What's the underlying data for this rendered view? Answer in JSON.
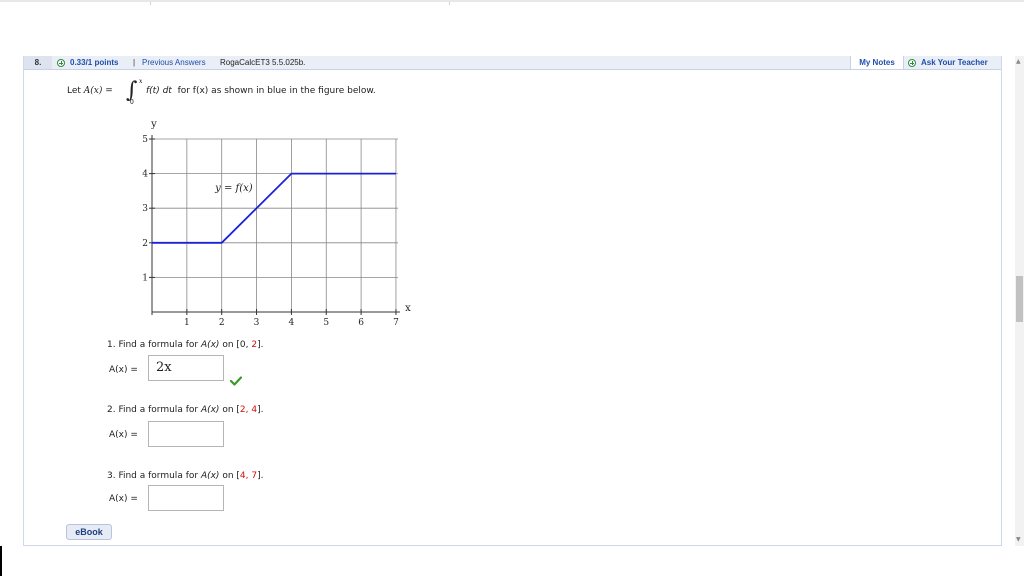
{
  "question": {
    "number": "8.",
    "points": "0.33/1 points",
    "separator": "|",
    "previous_answers": "Previous Answers",
    "code": "RogaCalcET3 5.5.025b.",
    "my_notes": "My Notes",
    "ask_teacher": "Ask Your Teacher"
  },
  "prompt": {
    "let_text": "Let",
    "A_of_x": "A(x) =",
    "integral_sign": "∫",
    "upper_limit": "x",
    "lower_limit": "0",
    "integrand": "f(t) dt",
    "rest": "for f(x) as shown in blue in the figure below."
  },
  "chart_data": {
    "type": "line",
    "ylabel": "y",
    "xlabel": "x",
    "xlim": [
      0,
      7
    ],
    "ylim": [
      0,
      5
    ],
    "x_ticks": [
      "1",
      "2",
      "3",
      "4",
      "5",
      "6",
      "7"
    ],
    "y_ticks": [
      "1",
      "2",
      "3",
      "4",
      "5"
    ],
    "grid": true,
    "annotation": "y = f(x)",
    "color": "#1a22d6",
    "series": [
      {
        "x": [
          0,
          2,
          4,
          7
        ],
        "y": [
          2,
          2,
          4,
          4
        ]
      }
    ]
  },
  "parts": [
    {
      "title_pre": "1. Find a formula for ",
      "var": "A(x)",
      "title_mid": " on ",
      "interval_open": "[0, ",
      "interval_red": "2",
      "interval_close": "].",
      "label": "A(x) =",
      "value": "2x",
      "status": "correct"
    },
    {
      "title_pre": "2. Find a formula for ",
      "var": "A(x)",
      "title_mid": " on ",
      "interval_open": "[",
      "interval_red": "2, 4",
      "interval_close": "].",
      "label": "A(x) =",
      "value": "",
      "status": ""
    },
    {
      "title_pre": "3. Find a formula for ",
      "var": "A(x)",
      "title_mid": " on ",
      "interval_open": "[",
      "interval_red": "4, 7",
      "interval_close": "].",
      "label": "A(x) =",
      "value": "",
      "status": ""
    }
  ],
  "ebook_label": "eBook",
  "colors": {
    "link": "#1f4fa8",
    "header_bg": "#e9eef7",
    "check": "#3a9a2a",
    "red": "#d01010"
  }
}
